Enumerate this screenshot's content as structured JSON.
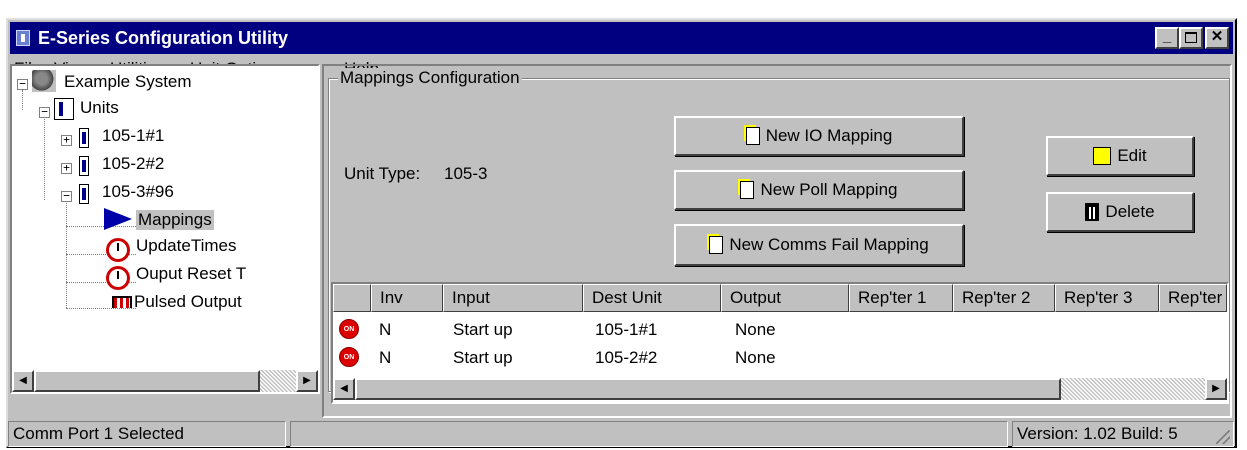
{
  "window": {
    "title": "E-Series Configuration Utility"
  },
  "menu": [
    {
      "label": "File"
    },
    {
      "label": "View"
    },
    {
      "label": "Utilities"
    },
    {
      "label": "Unit Options"
    },
    {
      "label": "Help"
    }
  ],
  "tree": {
    "root": "Example System",
    "units": "Units",
    "unit1": "105-1#1",
    "unit2": "105-2#2",
    "unit3": "105-3#96",
    "mappings": "Mappings",
    "update_times": "UpdateTimes",
    "output_reset": "Ouput Reset T",
    "pulsed_output": "Pulsed Output"
  },
  "mappings_panel": {
    "group_title": "Mappings Configuration",
    "unit_type_label": "Unit Type:",
    "unit_type_value": "105-3",
    "new_io_label": "New IO Mapping",
    "new_poll_label": "New Poll Mapping",
    "new_comms_fail_label": "New Comms Fail Mapping",
    "edit_label": "Edit",
    "delete_label": "Delete"
  },
  "table": {
    "columns": [
      "",
      "Inv",
      "Input",
      "Dest Unit",
      "Output",
      "Rep'ter 1",
      "Rep'ter 2",
      "Rep'ter 3",
      "Rep'ter"
    ],
    "rows": [
      {
        "icon": "ON",
        "inv": "N",
        "input": "Start up",
        "dest": "105-1#1",
        "output": "None"
      },
      {
        "icon": "ON",
        "inv": "N",
        "input": "Start up",
        "dest": "105-2#2",
        "output": "None"
      }
    ]
  },
  "status": {
    "left": "Comm Port 1 Selected",
    "middle": "",
    "right": "Version: 1.02 Build: 5"
  },
  "colors": {
    "titlebar": "#000080",
    "face": "#c0c0c0",
    "selection": "#c0c0c0"
  }
}
